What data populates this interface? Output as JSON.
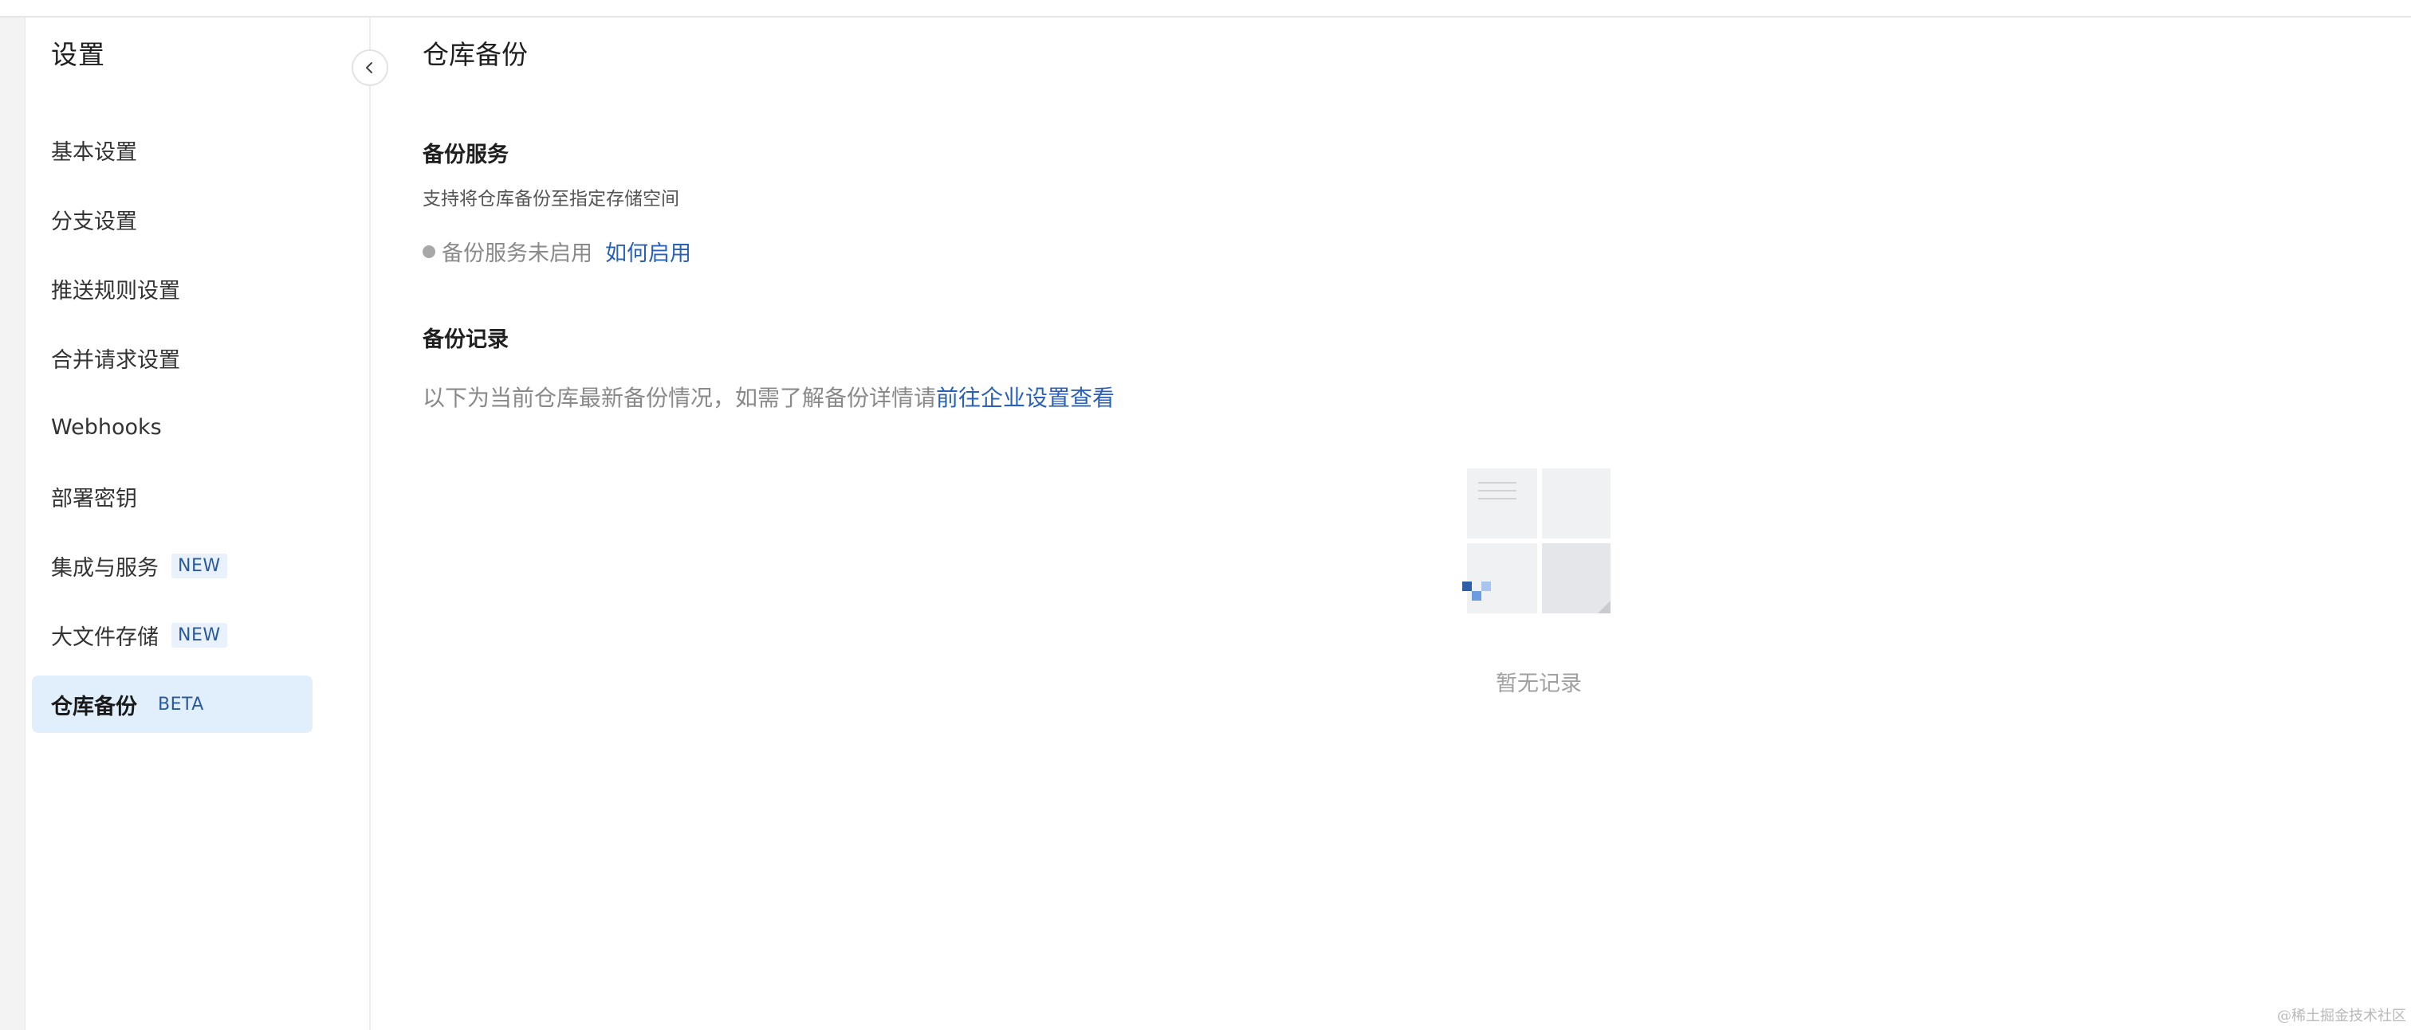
{
  "sidebar": {
    "title": "设置",
    "items": [
      {
        "label": "基本设置",
        "badge": ""
      },
      {
        "label": "分支设置",
        "badge": ""
      },
      {
        "label": "推送规则设置",
        "badge": ""
      },
      {
        "label": "合并请求设置",
        "badge": ""
      },
      {
        "label": "Webhooks",
        "badge": ""
      },
      {
        "label": "部署密钥",
        "badge": ""
      },
      {
        "label": "集成与服务",
        "badge": "NEW"
      },
      {
        "label": "大文件存储",
        "badge": "NEW"
      },
      {
        "label": "仓库备份",
        "badge": "BETA",
        "active": true
      }
    ]
  },
  "main": {
    "title": "仓库备份",
    "backup_service": {
      "title": "备份服务",
      "description": "支持将仓库备份至指定存储空间",
      "status_text": "备份服务未启用",
      "status_link": "如何启用"
    },
    "backup_records": {
      "title": "备份记录",
      "description": "以下为当前仓库最新备份情况，如需了解备份详情请",
      "description_link": "前往企业设置查看",
      "empty_text": "暂无记录"
    }
  },
  "watermark": "@稀土掘金技术社区",
  "colors": {
    "accent": "#2a61b8",
    "active_bg": "#e1effd",
    "badge_bg": "#e8f1fc",
    "muted_text": "#8a8a8a"
  }
}
